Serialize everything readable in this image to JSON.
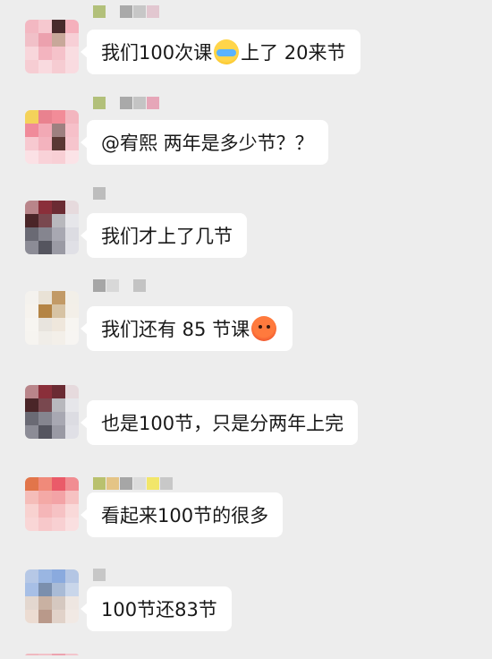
{
  "messages": [
    {
      "parts": [
        "我们100次课",
        "上了 20来节"
      ],
      "emoji": "crying-face-emoji"
    },
    {
      "parts": [
        "@宥熙 两年是多少节？？"
      ]
    },
    {
      "parts": [
        "我们才上了几节"
      ]
    },
    {
      "parts": [
        "我们还有 85 节课"
      ],
      "emoji": "angry-face-emoji"
    },
    {
      "parts": [
        "也是100节，只是分两年上完"
      ]
    },
    {
      "parts": [
        "看起来100节的很多"
      ]
    },
    {
      "parts": [
        "100节还83节"
      ]
    }
  ]
}
